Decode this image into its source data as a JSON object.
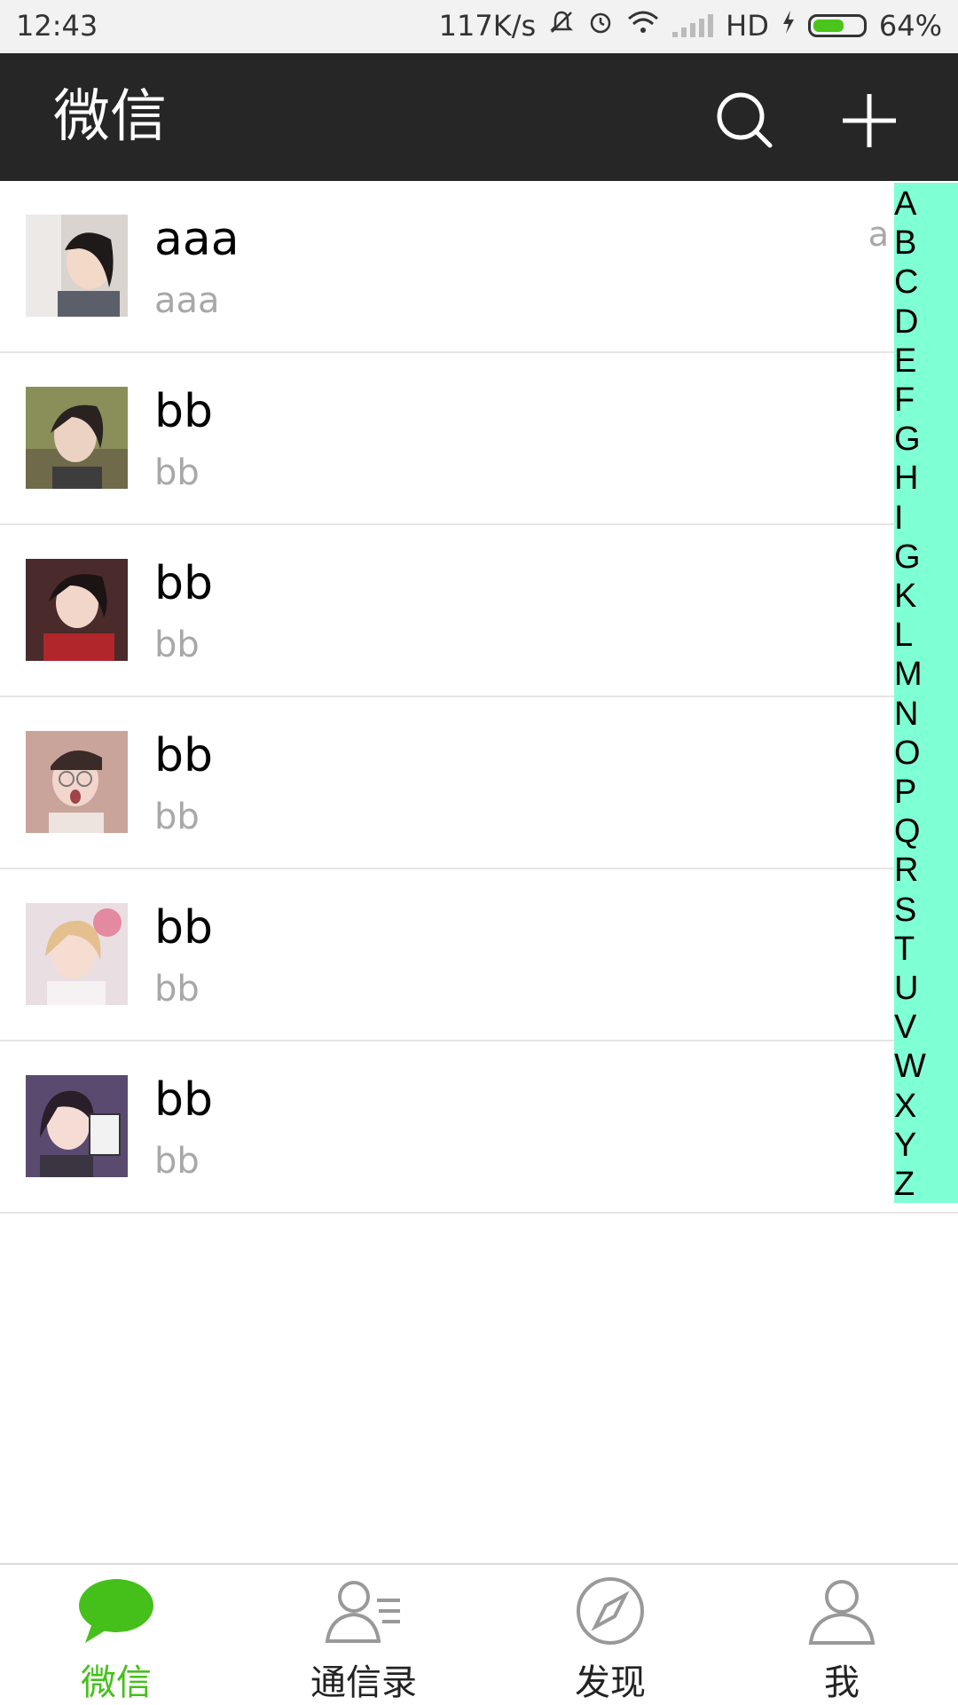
{
  "status": {
    "time": "12:43",
    "speed": "117K/s",
    "network": "HD",
    "battery_percent": "64%",
    "battery_level": 0.64
  },
  "header": {
    "title": "微信"
  },
  "contacts": [
    {
      "name": "aaa",
      "subtitle": "aaa",
      "tag": "a",
      "avatar": "avatar-1"
    },
    {
      "name": "bb",
      "subtitle": "bb",
      "avatar": "avatar-2"
    },
    {
      "name": "bb",
      "subtitle": "bb",
      "avatar": "avatar-3"
    },
    {
      "name": "bb",
      "subtitle": "bb",
      "avatar": "avatar-4"
    },
    {
      "name": "bb",
      "subtitle": "bb",
      "avatar": "avatar-5"
    },
    {
      "name": "bb",
      "subtitle": "bb",
      "avatar": "avatar-6"
    }
  ],
  "index_letters": [
    "A",
    "B",
    "C",
    "D",
    "E",
    "F",
    "G",
    "H",
    "I",
    "G",
    "K",
    "L",
    "M",
    "N",
    "O",
    "P",
    "Q",
    "R",
    "S",
    "T",
    "U",
    "V",
    "W",
    "X",
    "Y",
    "Z"
  ],
  "tabs": [
    {
      "label": "微信",
      "icon": "chat-bubble-icon",
      "active": true
    },
    {
      "label": "通信录",
      "icon": "contacts-icon",
      "active": false
    },
    {
      "label": "发现",
      "icon": "compass-icon",
      "active": false
    },
    {
      "label": "我",
      "icon": "person-icon",
      "active": false
    }
  ],
  "colors": {
    "appbar": "#262626",
    "accent": "#45c01a",
    "index_bar": "#7fffd4"
  }
}
